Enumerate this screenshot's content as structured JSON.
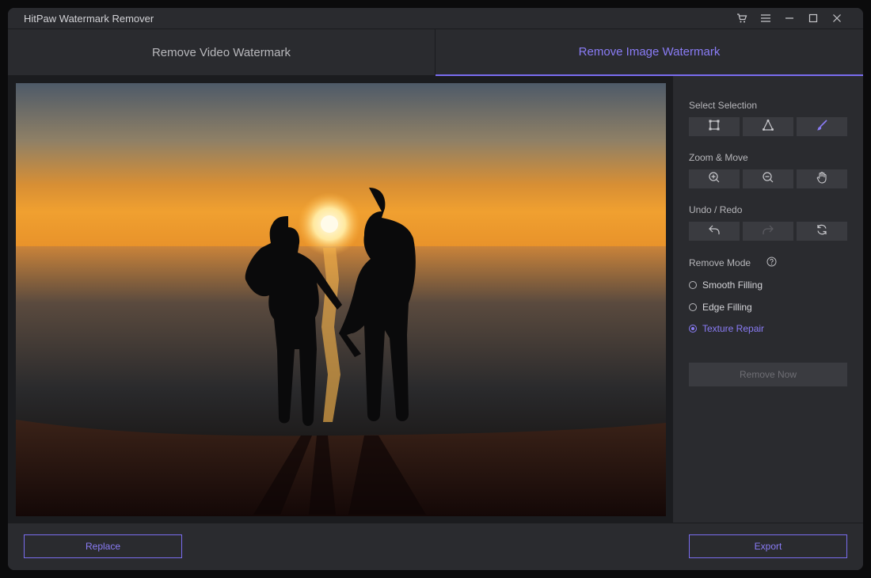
{
  "window": {
    "title": "HitPaw Watermark Remover"
  },
  "tabs": [
    {
      "label": "Remove Video Watermark",
      "active": false
    },
    {
      "label": "Remove Image Watermark",
      "active": true
    }
  ],
  "panel": {
    "select_selection": {
      "label": "Select Selection",
      "tools": [
        "rectangle-select-icon",
        "polygon-select-icon",
        "brush-icon"
      ],
      "active_tool": "brush-icon"
    },
    "zoom_move": {
      "label": "Zoom & Move",
      "tools": [
        "zoom-in-icon",
        "zoom-out-icon",
        "hand-icon"
      ]
    },
    "undo_redo": {
      "label": "Undo / Redo",
      "tools": [
        "undo-icon",
        "redo-icon",
        "reset-icon"
      ]
    },
    "remove_mode": {
      "label": "Remove Mode",
      "options": [
        {
          "label": "Smooth Filling",
          "selected": false
        },
        {
          "label": "Edge Filling",
          "selected": false
        },
        {
          "label": "Texture Repair",
          "selected": true
        }
      ]
    },
    "remove_now_label": "Remove Now"
  },
  "footer": {
    "replace_label": "Replace",
    "export_label": "Export"
  },
  "colors": {
    "accent": "#8a7cf6",
    "panel_bg": "#2a2b2f",
    "button_bg": "#3a3b40"
  },
  "icons": {
    "cart": "cart-icon",
    "menu": "menu-icon",
    "minimize": "minimize-icon",
    "maximize": "maximize-icon",
    "close": "close-icon",
    "help": "help-icon"
  }
}
